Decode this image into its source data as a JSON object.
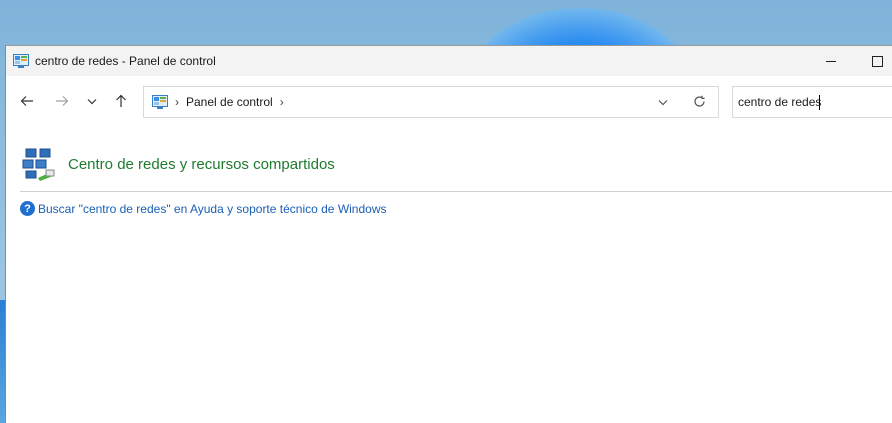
{
  "window": {
    "title": "centro de redes - Panel de control"
  },
  "navigation": {
    "back_icon": "arrow-left-icon",
    "forward_icon": "arrow-right-icon",
    "recent_icon": "chevron-down-icon",
    "up_icon": "arrow-up-icon"
  },
  "address_bar": {
    "location_icon": "control-panel-icon",
    "breadcrumb": [
      "Panel de control"
    ]
  },
  "search": {
    "value": "centro de redes"
  },
  "results": {
    "items": [
      {
        "title": "Centro de redes y recursos compartidos",
        "icon": "network-sharing-center-icon",
        "title_color": "#1e7b2f"
      }
    ],
    "help_link": "Buscar \"centro de redes\" en Ayuda y soporte técnico de Windows",
    "help_icon": "help-question-icon",
    "link_color": "#1a5fb4"
  }
}
